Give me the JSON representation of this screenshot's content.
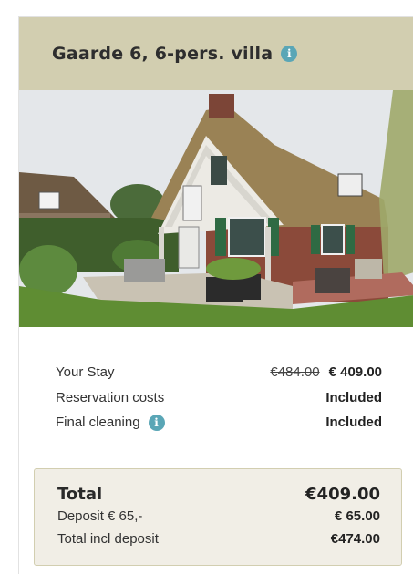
{
  "header": {
    "title": "Gaarde 6, 6-pers. villa",
    "info_icon": "info-icon"
  },
  "photo": {
    "alt": ""
  },
  "pricing": {
    "stay_label": "Your Stay",
    "stay_old_price": "€484.00",
    "stay_price": "€ 409.00",
    "reservation_label": "Reservation costs",
    "reservation_value": "Included",
    "cleaning_label": "Final cleaning",
    "cleaning_value": "Included"
  },
  "totals": {
    "total_label": "Total",
    "total_value": "€409.00",
    "deposit_label": "Deposit € 65,-",
    "deposit_value": "€ 65.00",
    "incl_label": "Total incl deposit",
    "incl_value": "€474.00"
  },
  "colors": {
    "header_bg": "#d2ceb0",
    "info_icon": "#5aa6b6",
    "totals_bg": "#f1eee6"
  }
}
